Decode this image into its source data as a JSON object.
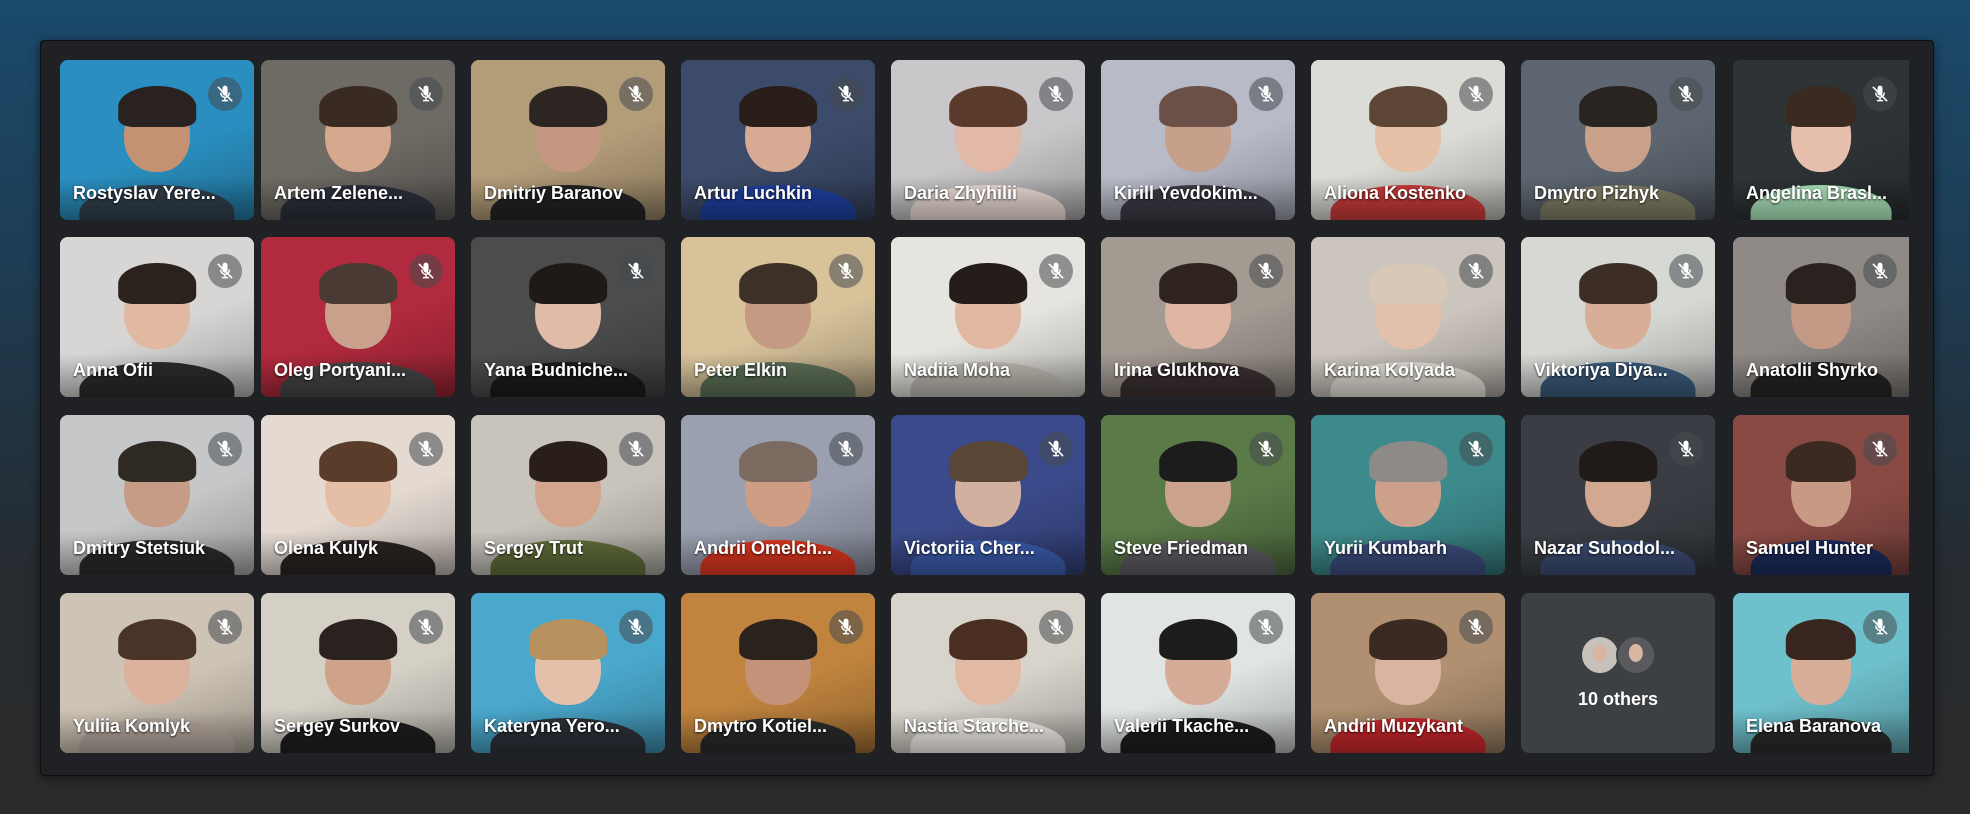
{
  "participants": [
    {
      "name": "Rostyslav Yere...",
      "bg": "#2a8fc0",
      "skin": "#c59173",
      "hair": "#2a2220",
      "shirt": "#2f3e4a"
    },
    {
      "name": "Artem Zelene...",
      "bg": "#6e6a64",
      "skin": "#d6a88e",
      "hair": "#3a2b22",
      "shirt": "#2b2e3a"
    },
    {
      "name": "Dmitriy Baranov",
      "bg": "#b39c78",
      "skin": "#c49880",
      "hair": "#2d2522",
      "shirt": "#222222"
    },
    {
      "name": "Artur Luchkin",
      "bg": "#3d4b6a",
      "skin": "#d8a993",
      "hair": "#2a1e1a",
      "shirt": "#1e3e9c"
    },
    {
      "name": "Daria Zhyhilii",
      "bg": "#c9c7c9",
      "skin": "#e1b9a6",
      "hair": "#5a3a2a",
      "shirt": "#e8d8d2"
    },
    {
      "name": "Kirill Yevdokim...",
      "bg": "#b8bac8",
      "skin": "#c7a08c",
      "hair": "#6a5046",
      "shirt": "#3a3a44"
    },
    {
      "name": "Aliona Kostenko",
      "bg": "#dcdcd6",
      "skin": "#e7c0a8",
      "hair": "#5e4636",
      "shirt": "#c63a3a"
    },
    {
      "name": "Dmytro Pizhyk",
      "bg": "#5d6670",
      "skin": "#c9a08a",
      "hair": "#2a2420",
      "shirt": "#7e7a64"
    },
    {
      "name": "Angelina Brasl...",
      "bg": "#2e3436",
      "skin": "#e6c0ad",
      "hair": "#3a2a22",
      "shirt": "#a9e0b8"
    },
    {
      "name": "Anna Ofii",
      "bg": "#d7d6d4",
      "skin": "#e1b8a2",
      "hair": "#2b221d",
      "shirt": "#2a2a2a"
    },
    {
      "name": "Oleg Portyani...",
      "bg": "#b12a3d",
      "skin": "#c8a08c",
      "hair": "#4a3a34",
      "shirt": "#434343"
    },
    {
      "name": "Yana Budniche...",
      "bg": "#4c4c4c",
      "skin": "#e0bba8",
      "hair": "#1f1a18",
      "shirt": "#1a1a1a"
    },
    {
      "name": "Peter Elkin",
      "bg": "#d7c29a",
      "skin": "#c49a82",
      "hair": "#3d3026",
      "shirt": "#5a6c55"
    },
    {
      "name": "Nadiia Moha",
      "bg": "#e6e4de",
      "skin": "#e1b9a2",
      "hair": "#231c18",
      "shirt": "#b7b4ac"
    },
    {
      "name": "Irina Glukhova",
      "bg": "#a39a92",
      "skin": "#dfb6a4",
      "hair": "#2e231f",
      "shirt": "#3a3030"
    },
    {
      "name": "Karina Kolyada",
      "bg": "#cbc5bd",
      "skin": "#e2c0ac",
      "hair": "#d8c8b6",
      "shirt": "#dedad2"
    },
    {
      "name": "Viktoriya Diya...",
      "bg": "#d6d8d4",
      "skin": "#d8ae98",
      "hair": "#3c2e26",
      "shirt": "#3a5a7a"
    },
    {
      "name": "Anatolii Shyrko",
      "bg": "#8f8a86",
      "skin": "#c49a86",
      "hair": "#2a221e",
      "shirt": "#232323"
    },
    {
      "name": "Dmitry Stetsiuk",
      "bg": "#c6c7c8",
      "skin": "#c69c86",
      "hair": "#2f2924",
      "shirt": "#2a2a2a"
    },
    {
      "name": "Olena Kulyk",
      "bg": "#e4dad2",
      "skin": "#e5bea6",
      "hair": "#5a3c2a",
      "shirt": "#2a2422"
    },
    {
      "name": "Sergey Trut",
      "bg": "#c8c4bc",
      "skin": "#d3a58c",
      "hair": "#2a1e18",
      "shirt": "#5e6a38"
    },
    {
      "name": "Andrii Omelch...",
      "bg": "#9aa0b0",
      "skin": "#cf9c84",
      "hair": "#7a6a60",
      "shirt": "#d9361f"
    },
    {
      "name": "Victoriia Cher...",
      "bg": "#3b4a8a",
      "skin": "#d2b0a0",
      "hair": "#5a4636",
      "shirt": "#3a5aa8"
    },
    {
      "name": "Steve Friedman",
      "bg": "#5a7a48",
      "skin": "#caa28e",
      "hair": "#1c1c1c",
      "shirt": "#5a5a60"
    },
    {
      "name": "Yurii Kumbarh",
      "bg": "#3d8a8c",
      "skin": "#cda08c",
      "hair": "#8e8a88",
      "shirt": "#3c4a7a"
    },
    {
      "name": "Nazar Suhodol...",
      "bg": "#3a3e44",
      "skin": "#d2a890",
      "hair": "#201a18",
      "shirt": "#3a4a70"
    },
    {
      "name": "Samuel Hunter",
      "bg": "#8a4a44",
      "skin": "#c89a86",
      "hair": "#3a2a22",
      "shirt": "#1a2a5a"
    },
    {
      "name": "Yuliia Komlyk",
      "bg": "#cec4b6",
      "skin": "#dcb19e",
      "hair": "#4a3428",
      "shirt": "#b0a49a"
    },
    {
      "name": "Sergey Surkov",
      "bg": "#d4d0c6",
      "skin": "#cfa28a",
      "hair": "#2a221e",
      "shirt": "#1e1e1e"
    },
    {
      "name": "Kateryna Yero...",
      "bg": "#4aa8cc",
      "skin": "#e4c0aa",
      "hair": "#b8925e",
      "shirt": "#2c3038"
    },
    {
      "name": "Dmytro Kotiel...",
      "bg": "#c0843e",
      "skin": "#c49278",
      "hair": "#2a221c",
      "shirt": "#2a2a2a"
    },
    {
      "name": "Nastia Starche...",
      "bg": "#d8d4cc",
      "skin": "#e2baa4",
      "hair": "#4a2e22",
      "shirt": "#f0ece6"
    },
    {
      "name": "Valerii Tkache...",
      "bg": "#e0e4e2",
      "skin": "#d6ac98",
      "hair": "#1c1c1c",
      "shirt": "#1c1c1c"
    },
    {
      "name": "Andrii Muzykant",
      "bg": "#b09070",
      "skin": "#dab4a0",
      "hair": "#3a2a22",
      "shirt": "#c4262a"
    },
    {
      "name": "Elena Baranova",
      "bg": "#6ec0cc",
      "skin": "#d9ae98",
      "hair": "#3a2620",
      "shirt": "#2a2a2a"
    }
  ],
  "others": {
    "label": "10 others",
    "avatar_colors": [
      "#c7c0bb",
      "#5a5a5e"
    ]
  },
  "colors": {
    "tile_bg": "#3c4043",
    "window_bg": "#202124"
  },
  "icons": {
    "mute": "mic-off-icon"
  }
}
